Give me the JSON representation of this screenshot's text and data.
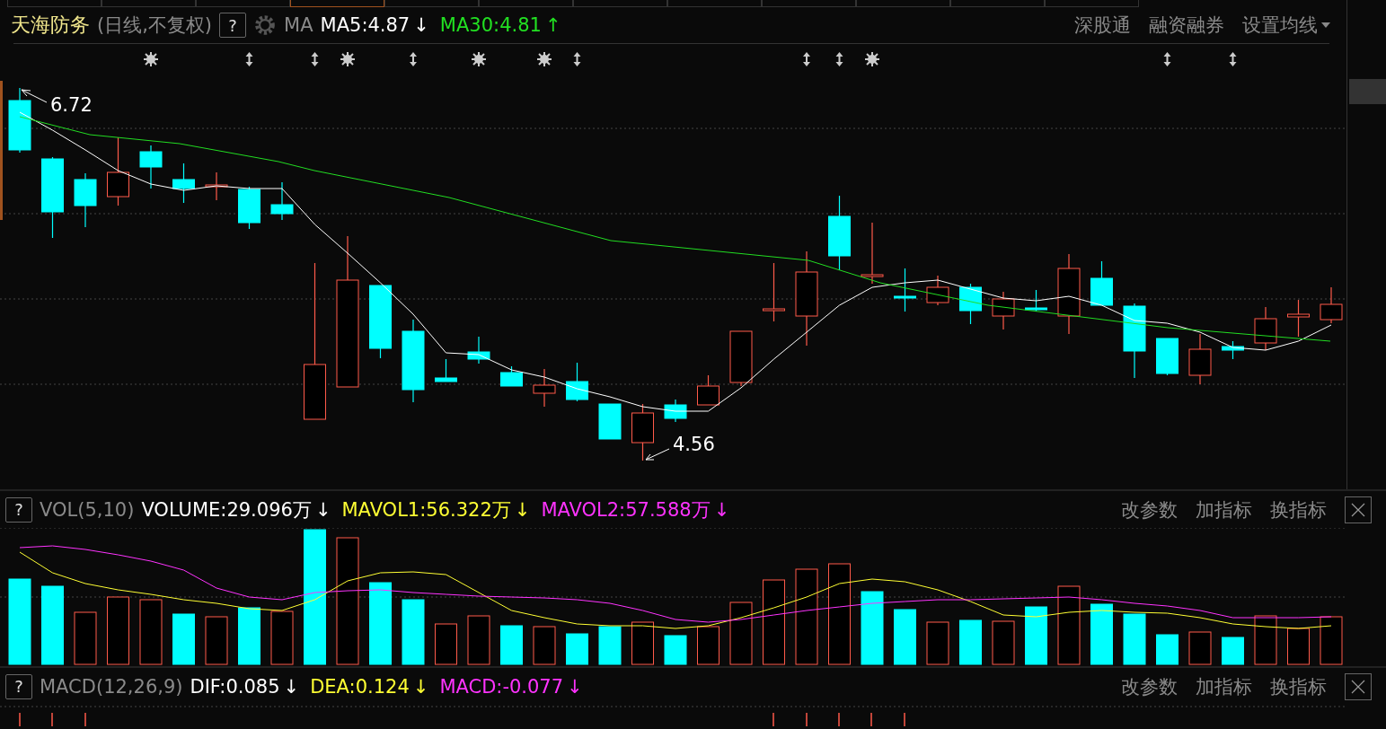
{
  "top_tabs": [
    {
      "selected": false
    },
    {
      "selected": false
    },
    {
      "selected": false
    },
    {
      "selected": true
    },
    {
      "selected": false
    },
    {
      "selected": false
    },
    {
      "selected": false
    },
    {
      "selected": false
    },
    {
      "selected": false
    },
    {
      "selected": false
    },
    {
      "selected": false
    },
    {
      "selected": false
    }
  ],
  "header": {
    "title": "天海防务",
    "subtitle": "(日线,不复权)",
    "help": "?",
    "indicator_name": "MA",
    "values": [
      {
        "label": "MA5:4.87",
        "arrow": "↓",
        "color": "#ffffff"
      },
      {
        "label": "MA30:4.81",
        "arrow": "↑",
        "color": "#22e022"
      }
    ],
    "links": [
      "深股通",
      "融资融券",
      "设置均线"
    ]
  },
  "price_chart": {
    "high_label": "6.72",
    "low_label": "4.56"
  },
  "volume_panel": {
    "help": "?",
    "indicator_name": "VOL(5,10)",
    "values": [
      {
        "label": "VOLUME:29.096万",
        "arrow": "↓",
        "color": "#ffffff"
      },
      {
        "label": "MAVOL1:56.322万",
        "arrow": "↓",
        "color": "#ffff33"
      },
      {
        "label": "MAVOL2:57.588万",
        "arrow": "↓",
        "color": "#ff33ff"
      }
    ],
    "buttons": [
      "改参数",
      "加指标",
      "换指标"
    ]
  },
  "macd_panel": {
    "help": "?",
    "indicator_name": "MACD(12,26,9)",
    "values": [
      {
        "label": "DIF:0.085",
        "arrow": "↓",
        "color": "#ffffff"
      },
      {
        "label": "DEA:0.124",
        "arrow": "↓",
        "color": "#ffff33"
      },
      {
        "label": "MACD:-0.077",
        "arrow": "↓",
        "color": "#ff33ff"
      }
    ],
    "buttons": [
      "改参数",
      "加指标",
      "换指标"
    ]
  }
}
